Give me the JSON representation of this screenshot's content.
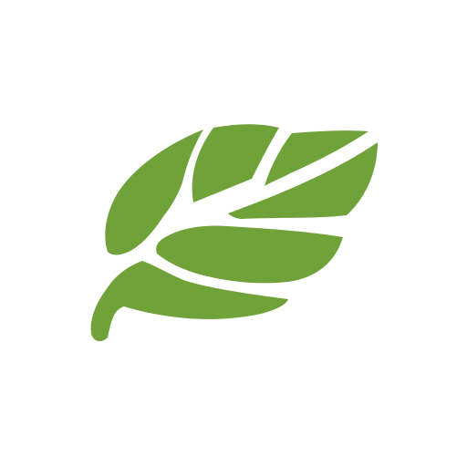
{
  "icon": {
    "name": "leaf-icon",
    "color": "#70a23a",
    "background": "#ffffff"
  }
}
